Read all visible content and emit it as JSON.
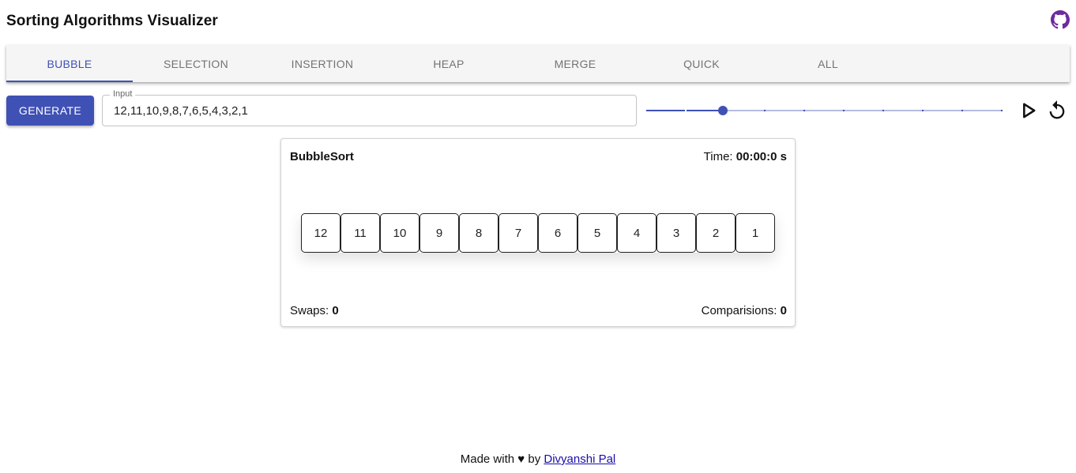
{
  "header": {
    "title": "Sorting Algorithms Visualizer",
    "github_icon": "github-icon"
  },
  "tabs": [
    {
      "label": "BUBBLE",
      "active": true
    },
    {
      "label": "SELECTION"
    },
    {
      "label": "INSERTION"
    },
    {
      "label": "HEAP"
    },
    {
      "label": "MERGE"
    },
    {
      "label": "QUICK"
    },
    {
      "label": "ALL"
    }
  ],
  "controls": {
    "generate_label": "GENERATE",
    "input_label": "Input",
    "input_value": "12,11,10,9,8,7,6,5,4,3,2,1",
    "speed_slider": {
      "value_step": 2,
      "steps": 10,
      "min_step": 0
    },
    "play_icon": "play-icon",
    "reset_icon": "reset-icon"
  },
  "card": {
    "title": "BubbleSort",
    "time_label": "Time:",
    "time_value": "00:00:0 s",
    "values": [
      "12",
      "11",
      "10",
      "9",
      "8",
      "7",
      "6",
      "5",
      "4",
      "3",
      "2",
      "1"
    ],
    "swaps_label": "Swaps:",
    "swaps_value": "0",
    "comparisons_label": "Comparisions:",
    "comparisons_value": "0"
  },
  "footer": {
    "prefix": "Made with",
    "heart": "♥",
    "by": "by",
    "author": "Divyanshi Pal"
  },
  "colors": {
    "accent": "#3f51b5",
    "github": "#6e2a9e"
  }
}
